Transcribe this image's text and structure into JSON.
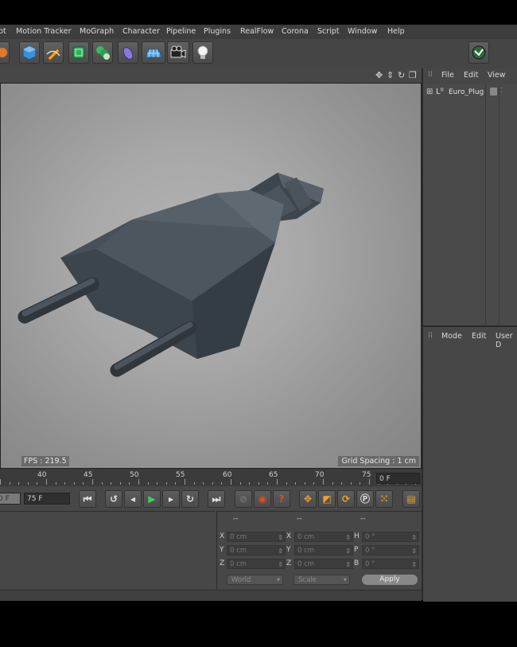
{
  "menu": {
    "items": [
      "pt",
      "Motion Tracker",
      "MoGraph",
      "Character",
      "Pipeline",
      "Plugins",
      "RealFlow",
      "Corona",
      "Script",
      "Window",
      "Help"
    ]
  },
  "toolbar": {
    "icons": [
      "cube-icon",
      "pen-icon",
      "subdivision-icon",
      "array-icon",
      "deformer-icon",
      "floor-icon",
      "camera-icon",
      "light-bulb-icon",
      "layout-icon"
    ]
  },
  "viewport": {
    "fps_label": "FPS : 219.5",
    "grid_spacing_label": "Grid Spacing : 1 cm",
    "background_color": "#a4a4a4",
    "model_color": "#4a535a"
  },
  "timeline": {
    "ticks": [
      "40",
      "45",
      "50",
      "55",
      "60",
      "65",
      "70",
      "75"
    ],
    "current_frame": "0 F"
  },
  "transport": {
    "start_field": "0 F",
    "end_field": "75 F"
  },
  "coordinates": {
    "header": [
      "--",
      "--",
      "--"
    ],
    "rows": [
      {
        "pos_label": "X",
        "pos_value": "0 cm",
        "size_label": "X",
        "size_value": "0 cm",
        "rot_label": "H",
        "rot_value": "0 °"
      },
      {
        "pos_label": "Y",
        "pos_value": "0 cm",
        "size_label": "Y",
        "size_value": "0 cm",
        "rot_label": "P",
        "rot_value": "0 °"
      },
      {
        "pos_label": "Z",
        "pos_value": "0 cm",
        "size_label": "Z",
        "size_value": "0 cm",
        "rot_label": "B",
        "rot_value": "0 °"
      }
    ],
    "mode_select": "World",
    "scale_select": "Scale",
    "apply_label": "Apply"
  },
  "object_manager": {
    "menu": [
      "File",
      "Edit",
      "View"
    ],
    "objects": [
      {
        "name": "Euro_Plug"
      }
    ]
  },
  "attribute_manager": {
    "menu": [
      "Mode",
      "Edit",
      "User D"
    ]
  }
}
